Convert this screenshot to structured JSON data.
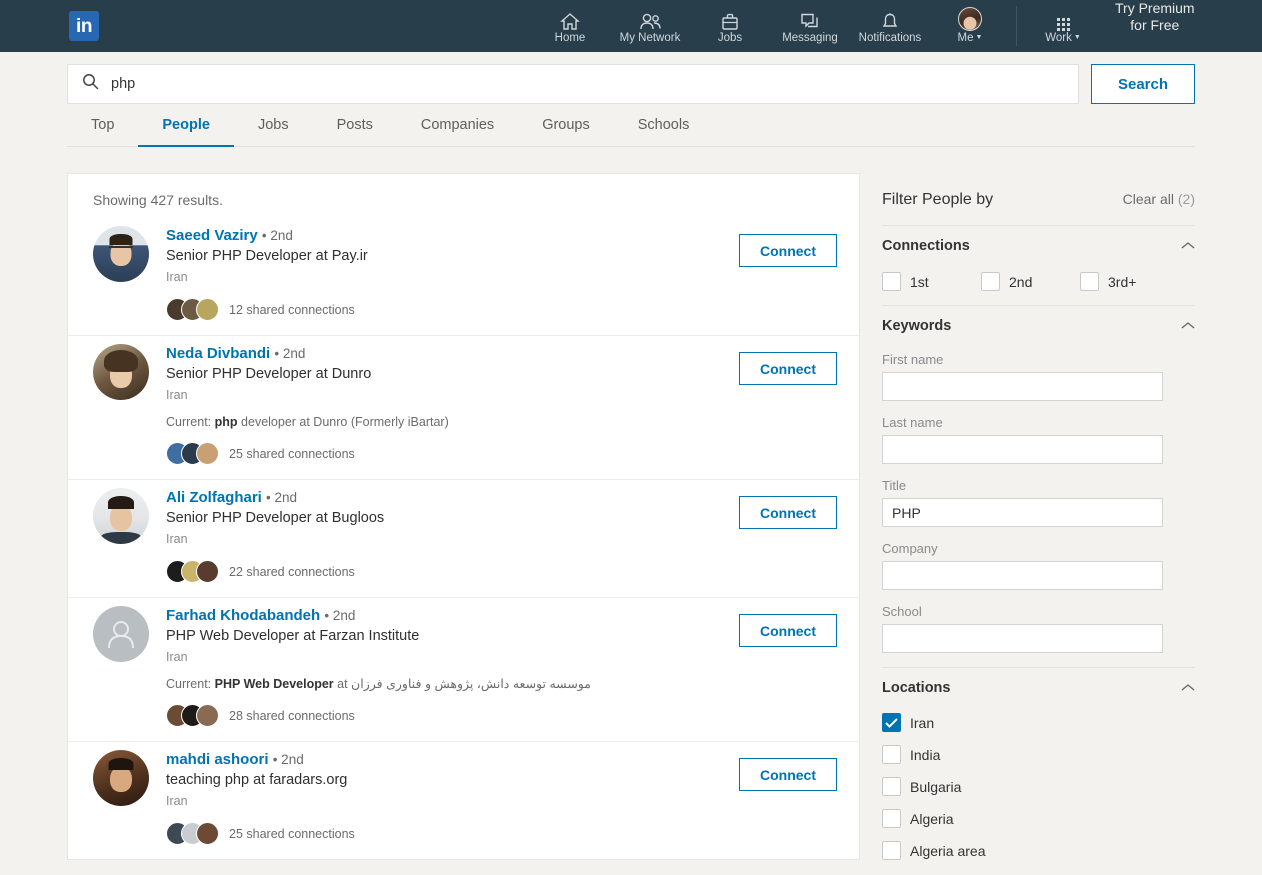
{
  "brand": {
    "logo_text": "in",
    "accent": "#0073b1",
    "nav_bg": "#283e4a",
    "page_bg": "#f3f2ef"
  },
  "nav": {
    "items": [
      {
        "label": "Home",
        "icon": "home-icon"
      },
      {
        "label": "My Network",
        "icon": "people-icon"
      },
      {
        "label": "Jobs",
        "icon": "briefcase-icon"
      },
      {
        "label": "Messaging",
        "icon": "message-icon"
      },
      {
        "label": "Notifications",
        "icon": "bell-icon"
      },
      {
        "label": "Me",
        "icon": "avatar-icon"
      }
    ],
    "work_label": "Work",
    "premium_line1": "Try Premium",
    "premium_line2": "for Free"
  },
  "search": {
    "value": "php",
    "placeholder": "Search",
    "button_label": "Search",
    "icon": "search-icon"
  },
  "tabs": [
    {
      "label": "Top",
      "active": false
    },
    {
      "label": "People",
      "active": true
    },
    {
      "label": "Jobs",
      "active": false
    },
    {
      "label": "Posts",
      "active": false
    },
    {
      "label": "Companies",
      "active": false
    },
    {
      "label": "Groups",
      "active": false
    },
    {
      "label": "Schools",
      "active": false
    }
  ],
  "results": {
    "count_text": "Showing 427 results.",
    "connect_label": "Connect",
    "items": [
      {
        "name": "Saeed Vaziry",
        "degree": "• 2nd",
        "headline": "Senior PHP Developer at Pay.ir",
        "location": "Iran",
        "current_prefix": "",
        "current_bold": "",
        "current_suffix": "",
        "shared": "12 shared connections",
        "photo_type": "photo",
        "photo_colors": [
          "#d8dde3",
          "#3c4a63",
          "#e3b48f"
        ]
      },
      {
        "name": "Neda Divbandi",
        "degree": "• 2nd",
        "headline": "Senior PHP Developer at Dunro",
        "location": "Iran",
        "current_prefix": "Current: ",
        "current_bold": "php",
        "current_suffix": " developer at Dunro (Formerly iBartar)",
        "shared": "25 shared connections",
        "photo_type": "photo",
        "photo_colors": [
          "#9c8f7a",
          "#5c4733",
          "#e7c9a8"
        ]
      },
      {
        "name": "Ali Zolfaghari",
        "degree": "• 2nd",
        "headline": "Senior PHP Developer at Bugloos",
        "location": "Iran",
        "current_prefix": "",
        "current_bold": "",
        "current_suffix": "",
        "shared": "22 shared connections",
        "photo_type": "photo",
        "photo_colors": [
          "#e9eaec",
          "#2b2b2b",
          "#e6c3a3"
        ]
      },
      {
        "name": "Farhad Khodabandeh",
        "degree": "• 2nd",
        "headline": "PHP Web Developer at Farzan Institute",
        "location": "Iran",
        "current_prefix": "Current: ",
        "current_bold": "PHP Web Developer",
        "current_suffix": " at ",
        "current_rtl": "موسسه توسعه دانش، پژوهش و فناوری فرزان",
        "shared": "28 shared connections",
        "photo_type": "placeholder",
        "photo_colors": [
          "#b9bec3",
          "#b9bec3",
          "#b9bec3"
        ]
      },
      {
        "name": "mahdi ashoori",
        "degree": "• 2nd",
        "headline": "teaching php at faradars.org",
        "location": "Iran",
        "current_prefix": "",
        "current_bold": "",
        "current_suffix": "",
        "shared": "25 shared connections",
        "photo_type": "photo",
        "photo_colors": [
          "#7a4f33",
          "#2e1f16",
          "#d9a87e"
        ]
      }
    ]
  },
  "filters": {
    "title": "Filter People by",
    "clear_all": "Clear all",
    "clear_all_count": "(2)",
    "connections": {
      "title": "Connections",
      "options": [
        {
          "label": "1st",
          "checked": false
        },
        {
          "label": "2nd",
          "checked": false
        },
        {
          "label": "3rd+",
          "checked": false
        }
      ]
    },
    "keywords": {
      "title": "Keywords",
      "fields": [
        {
          "label": "First name",
          "value": ""
        },
        {
          "label": "Last name",
          "value": ""
        },
        {
          "label": "Title",
          "value": "PHP"
        },
        {
          "label": "Company",
          "value": ""
        },
        {
          "label": "School",
          "value": ""
        }
      ]
    },
    "locations": {
      "title": "Locations",
      "options": [
        {
          "label": "Iran",
          "checked": true
        },
        {
          "label": "India",
          "checked": false
        },
        {
          "label": "Bulgaria",
          "checked": false
        },
        {
          "label": "Algeria",
          "checked": false
        },
        {
          "label": "Algeria area",
          "checked": false
        }
      ]
    }
  }
}
